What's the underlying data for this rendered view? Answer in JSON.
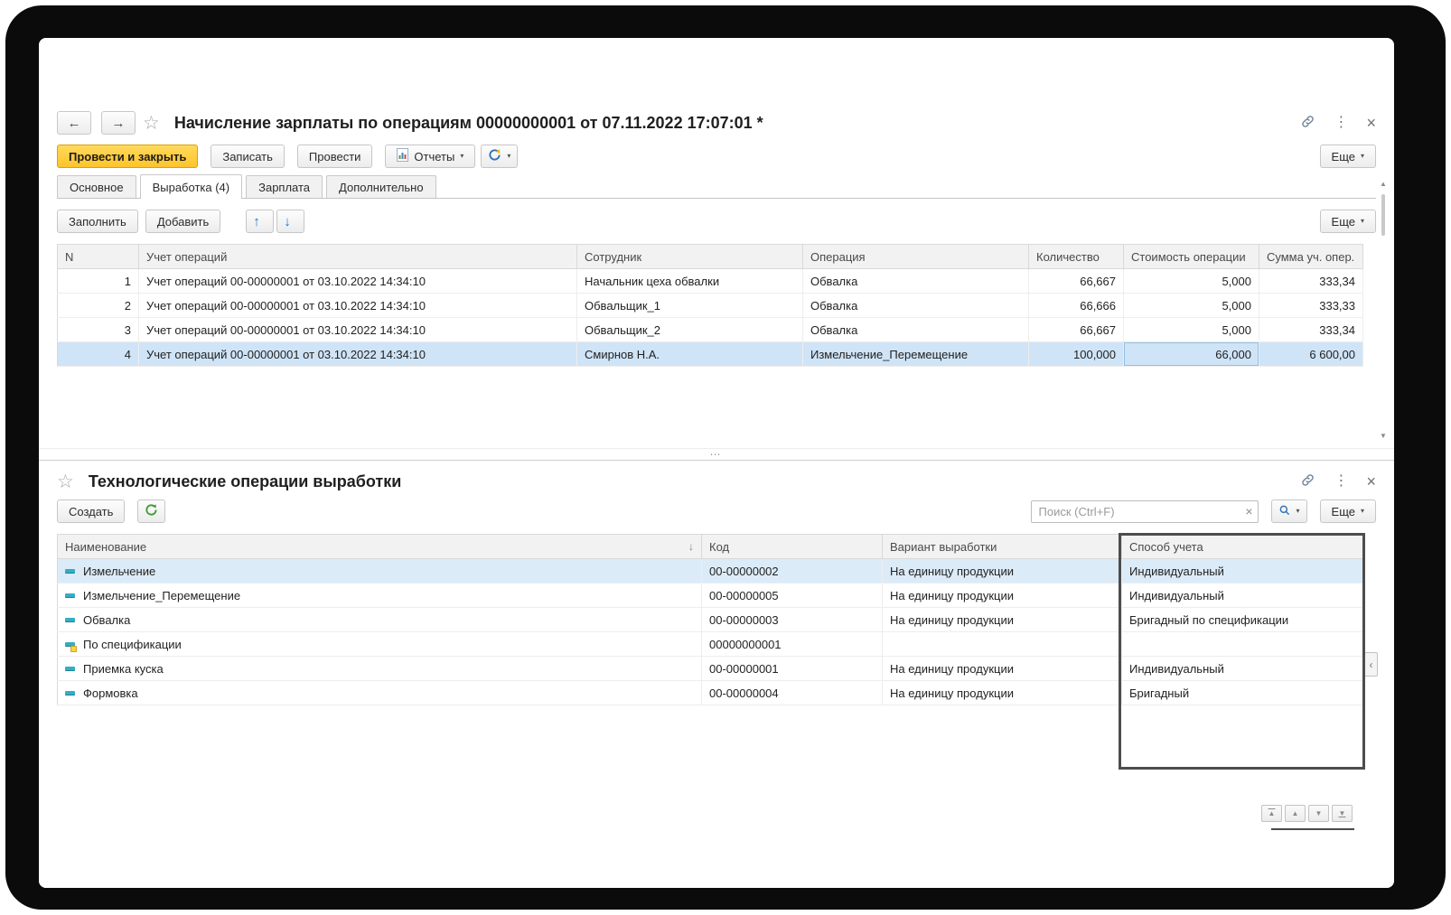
{
  "icons": {
    "back": "←",
    "forward": "→",
    "star": "☆",
    "menu_dots": "⋮",
    "close": "×",
    "caret": "▾",
    "move_up": "↑",
    "move_down": "↓",
    "sort_desc": "↓",
    "splitter_dots": "⋯",
    "clear": "×",
    "collapse_left": "‹",
    "scroll_up": "▲",
    "scroll_down": "▼",
    "page_first": "▲",
    "page_up": "▲",
    "page_down": "▼",
    "page_last": "▼"
  },
  "doc": {
    "title": "Начисление зарплаты по операциям 00000000001 от 07.11.2022 17:07:01 *",
    "toolbar": {
      "post_close": "Провести и закрыть",
      "save": "Записать",
      "post": "Провести",
      "reports": "Отчеты",
      "more": "Еще"
    },
    "tabs": [
      {
        "label": "Основное"
      },
      {
        "label": "Выработка (4)",
        "active": true
      },
      {
        "label": "Зарплата"
      },
      {
        "label": "Дополнительно"
      }
    ],
    "cmd": {
      "fill": "Заполнить",
      "add": "Добавить",
      "more": "Еще"
    },
    "table": {
      "columns": [
        "N",
        "Учет операций",
        "Сотрудник",
        "Операция",
        "Количество",
        "Стоимость операции",
        "Сумма уч. опер."
      ],
      "rows": [
        {
          "n": "1",
          "doc": "Учет операций 00-00000001 от 03.10.2022 14:34:10",
          "employee": "Начальник цеха обвалки",
          "operation": "Обвалка",
          "qty": "66,667",
          "cost": "5,000",
          "sum": "333,34"
        },
        {
          "n": "2",
          "doc": "Учет операций 00-00000001 от 03.10.2022 14:34:10",
          "employee": "Обвальщик_1",
          "operation": "Обвалка",
          "qty": "66,666",
          "cost": "5,000",
          "sum": "333,33"
        },
        {
          "n": "3",
          "doc": "Учет операций 00-00000001 от 03.10.2022 14:34:10",
          "employee": "Обвальщик_2",
          "operation": "Обвалка",
          "qty": "66,667",
          "cost": "5,000",
          "sum": "333,34"
        },
        {
          "n": "4",
          "doc": "Учет операций 00-00000001 от 03.10.2022 14:34:10",
          "employee": "Смирнов Н.А.",
          "operation": "Измельчение_Перемещение",
          "qty": "100,000",
          "cost": "66,000",
          "sum": "6 600,00",
          "selected": true,
          "selected_cell": "cost"
        }
      ]
    }
  },
  "list": {
    "title": "Технологические операции выработки",
    "toolbar": {
      "create": "Создать",
      "more": "Еще"
    },
    "search": {
      "placeholder": "Поиск (Ctrl+F)"
    },
    "table": {
      "columns": [
        "Наименование",
        "Код",
        "Вариант выработки",
        "Способ учета"
      ],
      "rows": [
        {
          "name": "Измельчение",
          "code": "00-00000002",
          "variant": "На единицу продукции",
          "method": "Индивидуальный",
          "icon": "item",
          "selected": true
        },
        {
          "name": "Измельчение_Перемещение",
          "code": "00-00000005",
          "variant": "На единицу продукции",
          "method": "Индивидуальный",
          "icon": "item"
        },
        {
          "name": "Обвалка",
          "code": "00-00000003",
          "variant": "На единицу продукции",
          "method": "Бригадный по спецификации",
          "icon": "item"
        },
        {
          "name": "По спецификации",
          "code": "00000000001",
          "variant": "",
          "method": "",
          "icon": "spec"
        },
        {
          "name": "Приемка куска",
          "code": "00-00000001",
          "variant": "На единицу продукции",
          "method": "Индивидуальный",
          "icon": "item"
        },
        {
          "name": "Формовка",
          "code": "00-00000004",
          "variant": "На единицу продукции",
          "method": "Бригадный",
          "icon": "item"
        }
      ]
    }
  }
}
